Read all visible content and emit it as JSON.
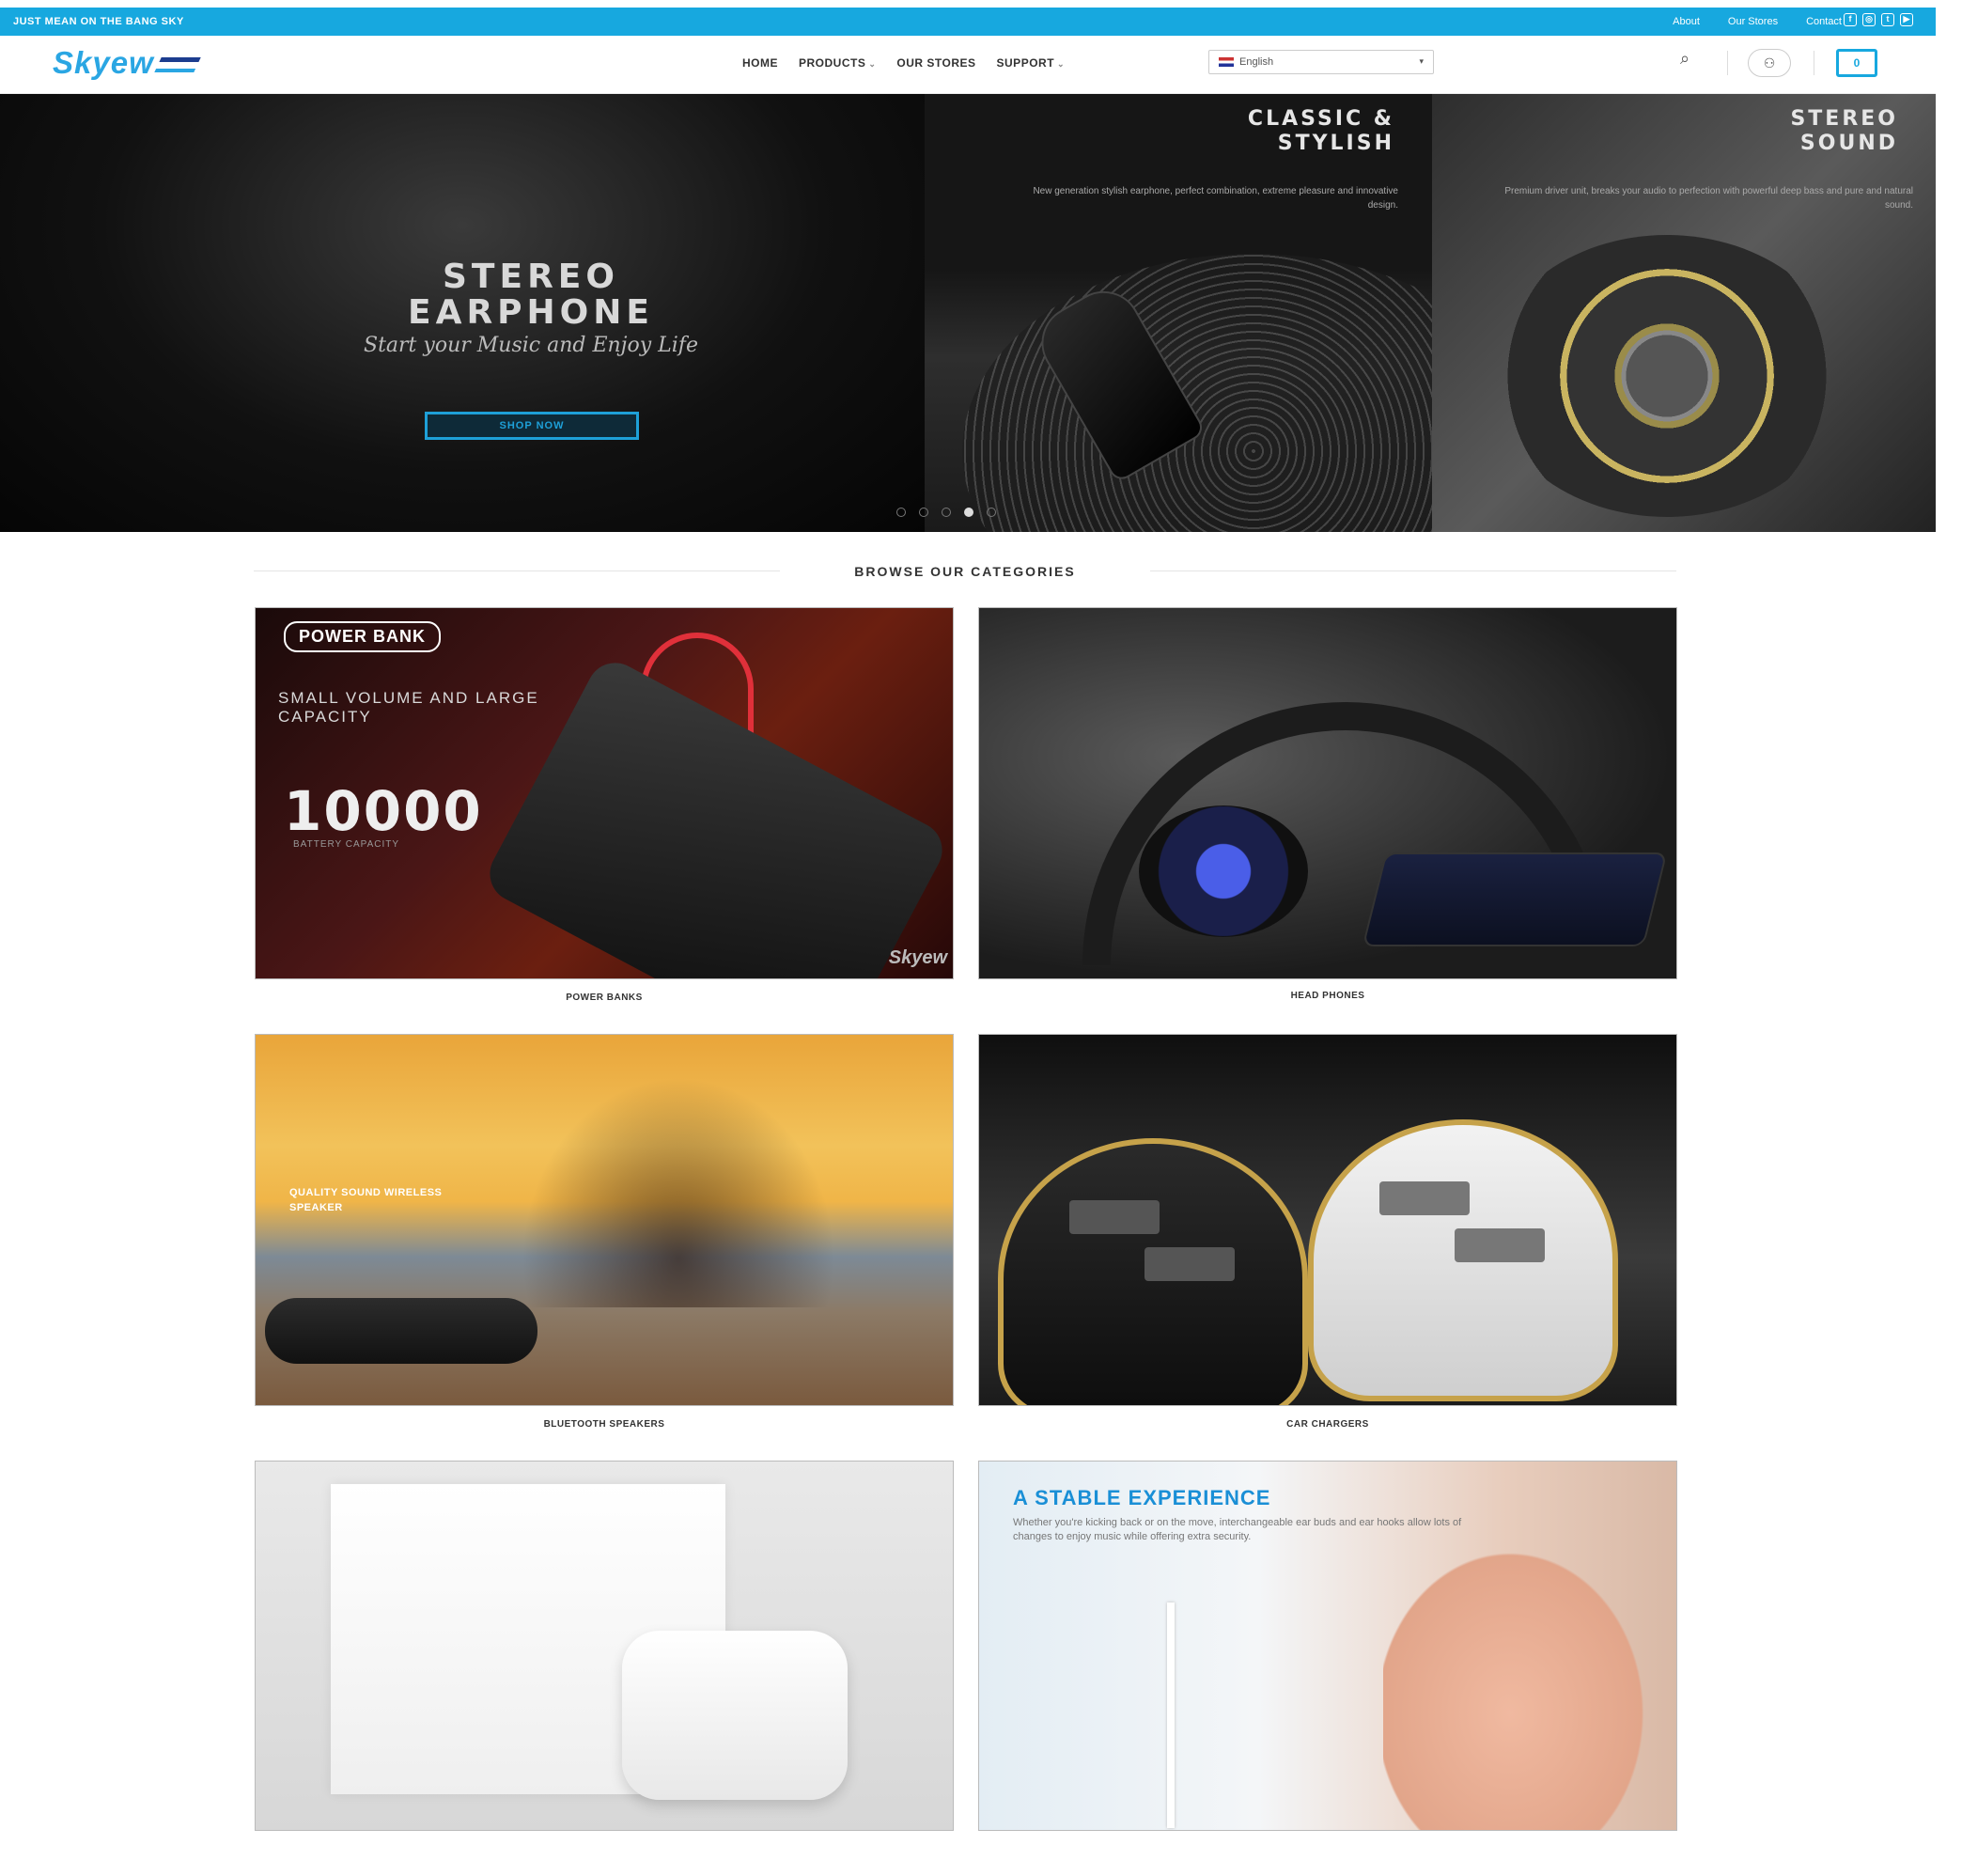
{
  "topbar": {
    "promo": "JUST MEAN ON THE BANG SKY",
    "links": [
      "About",
      "Our Stores",
      "Contact"
    ],
    "social_icons": [
      "facebook-icon",
      "instagram-icon",
      "twitter-icon",
      "youtube-icon"
    ],
    "color": "#17a8df"
  },
  "header": {
    "logo": "Skyew",
    "nav": [
      {
        "label": "HOME",
        "dropdown": false
      },
      {
        "label": "PRODUCTS",
        "dropdown": true
      },
      {
        "label": "OUR STORES",
        "dropdown": false
      },
      {
        "label": "SUPPORT",
        "dropdown": true
      }
    ],
    "language": "English",
    "icons": [
      "search-icon",
      "user-icon",
      "cart-icon"
    ],
    "cart_count": "0"
  },
  "hero": {
    "main_title": "STEREO EARPHONE",
    "script": "Start your Music and Enjoy Life",
    "button": "SHOP NOW",
    "panel2_title": "CLASSIC & STYLISH",
    "panel2_sub": "New generation stylish earphone, perfect combination, extreme pleasure and innovative design.",
    "panel3_title": "STEREO SOUND",
    "panel3_sub": "Premium driver unit, breaks your audio to perfection with powerful deep bass and pure and natural sound.",
    "slide_count": 5,
    "active_slide": 4
  },
  "categories": {
    "heading": "BROWSE OUR CATEGORIES",
    "items": [
      {
        "label": "POWER BANKS"
      },
      {
        "label": "HEAD PHONES"
      },
      {
        "label": "BLUETOOTH SPEAKERS"
      },
      {
        "label": "CAR CHARGERS"
      },
      {
        "label": ""
      },
      {
        "label": ""
      }
    ],
    "powerbank": {
      "badge": "POWER BANK",
      "headline": "SMALL VOLUME AND LARGE CAPACITY",
      "number": "10000",
      "caption": "BATTERY CAPACITY",
      "brand": "Skyew"
    },
    "speaker_text": "QUALITY SOUND WIRELESS SPEAKER",
    "earphone": {
      "headline": "A STABLE EXPERIENCE",
      "text": "Whether you're kicking back or on the move, interchangeable ear buds and ear hooks allow lots of changes to enjoy music while offering extra security."
    }
  }
}
